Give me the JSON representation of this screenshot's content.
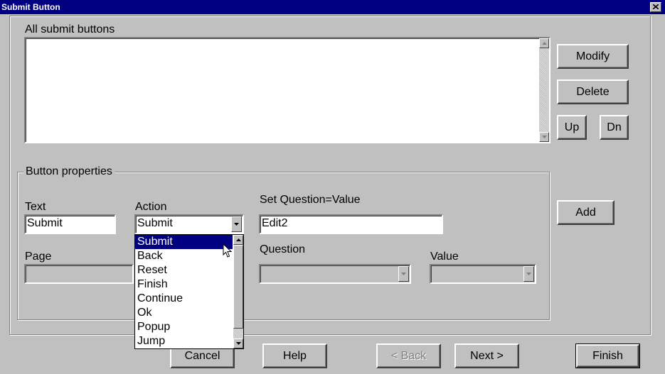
{
  "window": {
    "title": "Submit Button"
  },
  "all_buttons": {
    "label": "All submit buttons"
  },
  "side_buttons": {
    "modify": "Modify",
    "delete": "Delete",
    "up": "Up",
    "dn": "Dn",
    "add": "Add"
  },
  "props": {
    "legend": "Button properties",
    "text_label": "Text",
    "text_value": "Submit",
    "action_label": "Action",
    "action_value": "Submit",
    "action_options": [
      "Submit",
      "Back",
      "Reset",
      "Finish",
      "Continue",
      "Ok",
      "Popup",
      "Jump"
    ],
    "setq_label": "Set Question=Value",
    "setq_value": "Edit2",
    "page_label": "Page",
    "question_label": "Question",
    "value_label": "Value"
  },
  "footer": {
    "cancel": "Cancel",
    "help": "Help",
    "back": "< Back",
    "next": "Next >",
    "finish": "Finish"
  }
}
